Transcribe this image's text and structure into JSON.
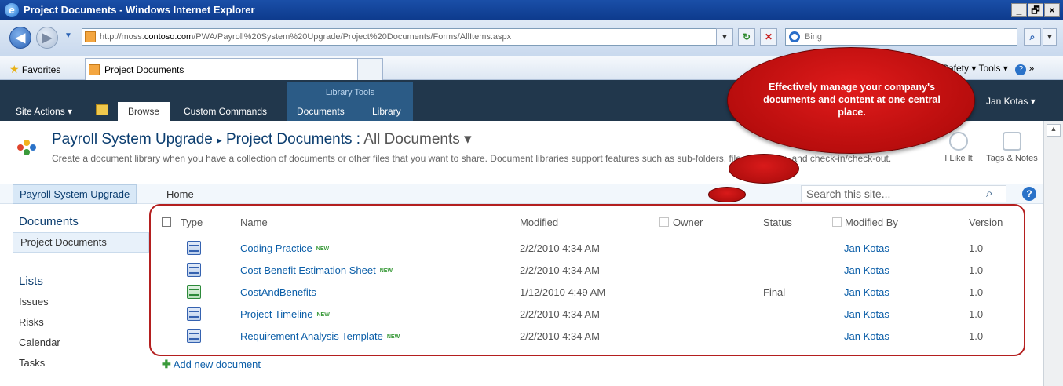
{
  "browser": {
    "window_title": "Project Documents - Windows Internet Explorer",
    "window_buttons": [
      "_",
      "🗗",
      "×"
    ],
    "url_prefix": "http://moss.",
    "url_domain": "contoso.com",
    "url_path": "/PWA/Payroll%20System%20Upgrade/Project%20Documents/Forms/AllItems.aspx",
    "search_placeholder": "Bing",
    "favorites_label": "Favorites",
    "tab_label": "Project Documents",
    "toolbar_right": "Safety ▾   Tools ▾",
    "overflow": "»"
  },
  "ribbon": {
    "site_actions": "Site Actions ▾",
    "browse": "Browse",
    "custom_commands": "Custom Commands",
    "library_tools": "Library Tools",
    "documents": "Documents",
    "library": "Library",
    "user": "Jan Kotas ▾"
  },
  "header": {
    "site": "Payroll System Upgrade",
    "separator": "▸",
    "library": "Project Documents",
    "colon": ":",
    "view": "All Documents ▾",
    "description": "Create a document library when you have a collection of documents or other files that you want to share. Document libraries support features such as sub-folders, file versioning, and check-in/check-out.",
    "i_like_it": "I Like It",
    "tags_notes": "Tags & Notes"
  },
  "topnav": {
    "current": "Payroll System Upgrade",
    "home": "Home",
    "search_placeholder": "Search this site...",
    "help": "?"
  },
  "quicklaunch": {
    "documents_head": "Documents",
    "project_documents": "Project Documents",
    "lists_head": "Lists",
    "issues": "Issues",
    "risks": "Risks",
    "calendar": "Calendar",
    "tasks": "Tasks"
  },
  "table": {
    "headers": {
      "type": "Type",
      "name": "Name",
      "modified": "Modified",
      "owner": "Owner",
      "status": "Status",
      "modified_by": "Modified By",
      "version": "Version"
    },
    "new_badge": "NEW",
    "rows": [
      {
        "name": "Coding Practice",
        "new": true,
        "modified": "2/2/2010 4:34 AM",
        "status": "",
        "modified_by": "Jan Kotas",
        "version": "1.0",
        "type": "word"
      },
      {
        "name": "Cost Benefit Estimation Sheet",
        "new": true,
        "modified": "2/2/2010 4:34 AM",
        "status": "",
        "modified_by": "Jan Kotas",
        "version": "1.0",
        "type": "word"
      },
      {
        "name": "CostAndBenefits",
        "new": false,
        "modified": "1/12/2010 4:49 AM",
        "status": "Final",
        "modified_by": "Jan Kotas",
        "version": "1.0",
        "type": "excel"
      },
      {
        "name": "Project Timeline",
        "new": true,
        "modified": "2/2/2010 4:34 AM",
        "status": "",
        "modified_by": "Jan Kotas",
        "version": "1.0",
        "type": "word"
      },
      {
        "name": "Requirement Analysis Template",
        "new": true,
        "modified": "2/2/2010 4:34 AM",
        "status": "",
        "modified_by": "Jan Kotas",
        "version": "1.0",
        "type": "word"
      }
    ],
    "add_new": "Add new document"
  },
  "callout": {
    "text": "Effectively manage your company's documents and content at one central place."
  }
}
